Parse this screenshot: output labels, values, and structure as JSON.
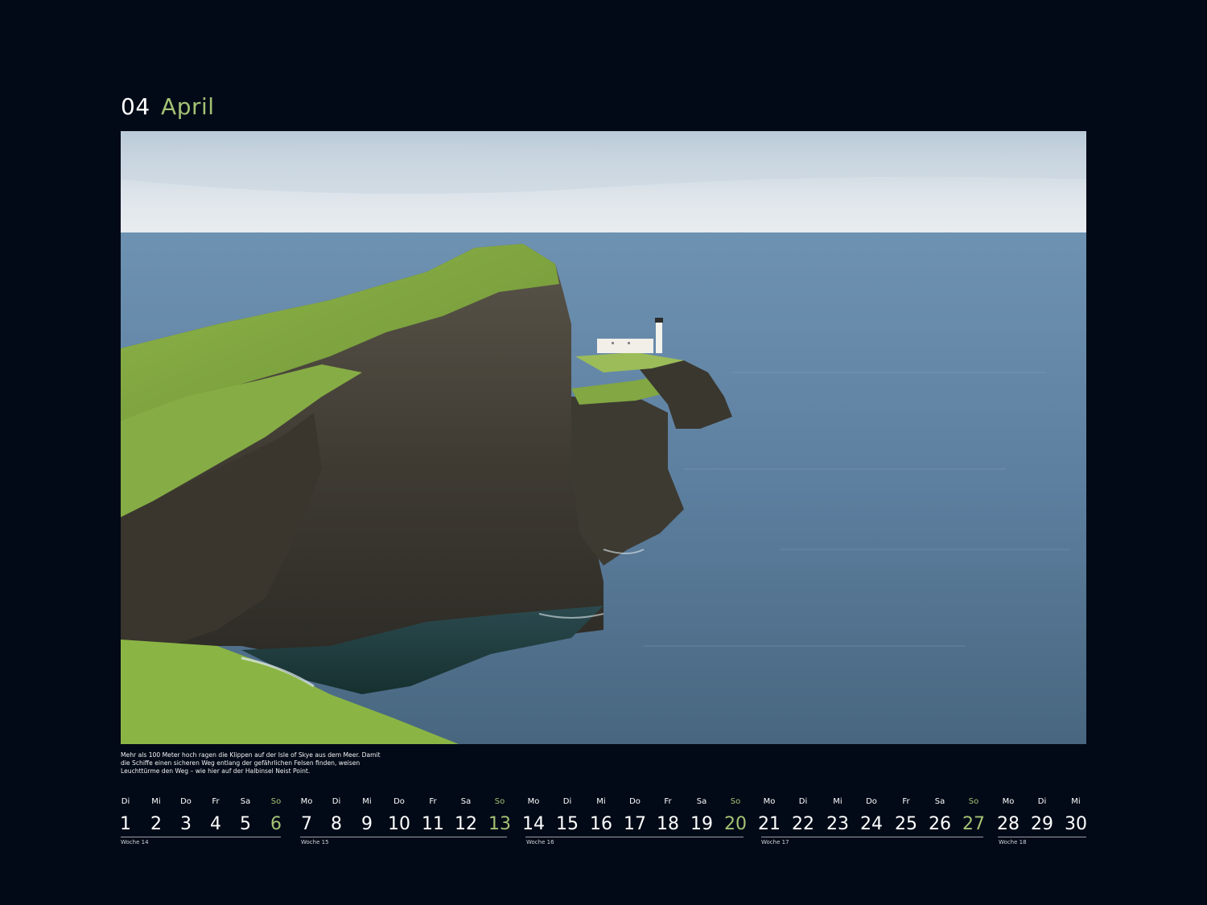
{
  "header": {
    "month_number": "04",
    "month_name": "April"
  },
  "photo": {
    "subject": "Neist Point lighthouse and sea cliffs, Isle of Skye"
  },
  "caption": {
    "line1": "Mehr als 100 Meter hoch ragen die Klippen auf der Isle of Skye aus dem Meer. Damit",
    "line2": "die Schiffe einen sicheren Weg entlang der gefährlichen Felsen finden, weisen",
    "line3": "Leuchttürme den Weg – wie hier auf der Halbinsel Neist Point."
  },
  "calendar": {
    "days": [
      {
        "dow": "Di",
        "date": "1"
      },
      {
        "dow": "Mi",
        "date": "2"
      },
      {
        "dow": "Do",
        "date": "3"
      },
      {
        "dow": "Fr",
        "date": "4"
      },
      {
        "dow": "Sa",
        "date": "5"
      },
      {
        "dow": "So",
        "date": "6"
      },
      {
        "dow": "Mo",
        "date": "7"
      },
      {
        "dow": "Di",
        "date": "8"
      },
      {
        "dow": "Mi",
        "date": "9"
      },
      {
        "dow": "Do",
        "date": "10"
      },
      {
        "dow": "Fr",
        "date": "11"
      },
      {
        "dow": "Sa",
        "date": "12"
      },
      {
        "dow": "So",
        "date": "13"
      },
      {
        "dow": "Mo",
        "date": "14"
      },
      {
        "dow": "Di",
        "date": "15"
      },
      {
        "dow": "Mi",
        "date": "16"
      },
      {
        "dow": "Do",
        "date": "17"
      },
      {
        "dow": "Fr",
        "date": "18"
      },
      {
        "dow": "Sa",
        "date": "19"
      },
      {
        "dow": "So",
        "date": "20"
      },
      {
        "dow": "Mo",
        "date": "21"
      },
      {
        "dow": "Di",
        "date": "22"
      },
      {
        "dow": "Mi",
        "date": "23"
      },
      {
        "dow": "Do",
        "date": "24"
      },
      {
        "dow": "Fr",
        "date": "25"
      },
      {
        "dow": "Sa",
        "date": "26"
      },
      {
        "dow": "So",
        "date": "27"
      },
      {
        "dow": "Mo",
        "date": "28"
      },
      {
        "dow": "Di",
        "date": "29"
      },
      {
        "dow": "Mi",
        "date": "30"
      }
    ],
    "weeks": [
      "Woche 14",
      "Woche 15",
      "Woche 16",
      "Woche 17",
      "Woche 18"
    ]
  },
  "colors": {
    "background": "#020a17",
    "accent_sunday": "#a4c274",
    "text": "#ffffff"
  }
}
